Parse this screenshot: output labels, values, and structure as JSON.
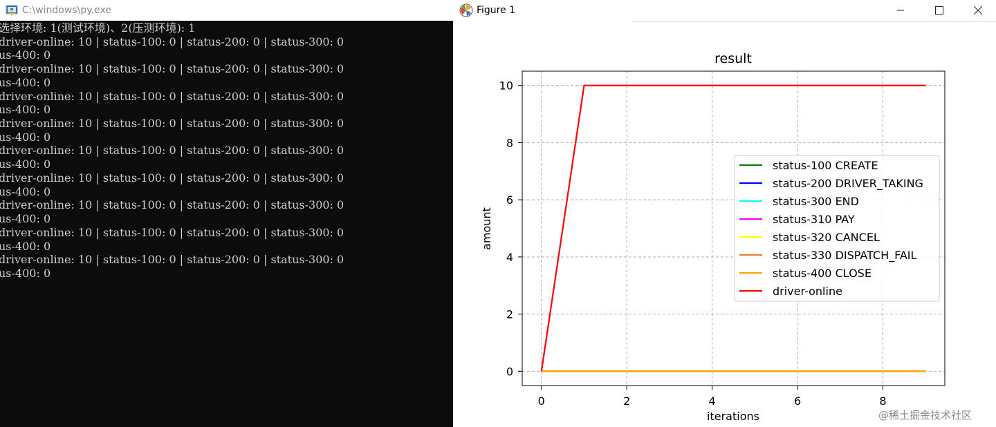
{
  "console": {
    "title": "C:\\windows\\py.exe",
    "lines": [
      "选择环境: 1(测试环境)、2(压测环境): 1",
      "driver-online: 10 | status-100: 0 | status-200: 0 | status-300: 0",
      "us-400: 0",
      "driver-online: 10 | status-100: 0 | status-200: 0 | status-300: 0",
      "us-400: 0",
      "driver-online: 10 | status-100: 0 | status-200: 0 | status-300: 0",
      "us-400: 0",
      "driver-online: 10 | status-100: 0 | status-200: 0 | status-300: 0",
      "us-400: 0",
      "driver-online: 10 | status-100: 0 | status-200: 0 | status-300: 0",
      "us-400: 0",
      "driver-online: 10 | status-100: 0 | status-200: 0 | status-300: 0",
      "us-400: 0",
      "driver-online: 10 | status-100: 0 | status-200: 0 | status-300: 0",
      "us-400: 0",
      "driver-online: 10 | status-100: 0 | status-200: 0 | status-300: 0",
      "us-400: 0",
      "driver-online: 10 | status-100: 0 | status-200: 0 | status-300: 0",
      "us-400: 0"
    ]
  },
  "figure_window": {
    "title": "Figure 1",
    "minimize_icon": "minimize-icon",
    "maximize_icon": "maximize-icon",
    "close_icon": "close-icon"
  },
  "chart_data": {
    "type": "line",
    "title": "result",
    "xlabel": "iterations",
    "ylabel": "amount",
    "x": [
      0,
      1,
      2,
      3,
      4,
      5,
      6,
      7,
      8,
      9
    ],
    "xlim": [
      -0.45,
      9.45
    ],
    "ylim": [
      -0.5,
      10.5
    ],
    "xticks": [
      0,
      2,
      4,
      6,
      8
    ],
    "yticks": [
      0,
      2,
      4,
      6,
      8,
      10
    ],
    "grid": true,
    "grid_style": "dashed",
    "legend_position": "center-right",
    "series": [
      {
        "name": "status-100 CREATE",
        "color": "#008000",
        "values": [
          0,
          0,
          0,
          0,
          0,
          0,
          0,
          0,
          0,
          0
        ]
      },
      {
        "name": "status-200 DRIVER_TAKING",
        "color": "#0000ff",
        "values": [
          0,
          0,
          0,
          0,
          0,
          0,
          0,
          0,
          0,
          0
        ]
      },
      {
        "name": "status-300 END",
        "color": "#00ffff",
        "values": [
          0,
          0,
          0,
          0,
          0,
          0,
          0,
          0,
          0,
          0
        ]
      },
      {
        "name": "status-310 PAY",
        "color": "#ff00ff",
        "values": [
          0,
          0,
          0,
          0,
          0,
          0,
          0,
          0,
          0,
          0
        ]
      },
      {
        "name": "status-320 CANCEL",
        "color": "#ffff00",
        "values": [
          0,
          0,
          0,
          0,
          0,
          0,
          0,
          0,
          0,
          0
        ]
      },
      {
        "name": "status-330 DISPATCH_FAIL",
        "color": "#ee7f2d",
        "values": [
          0,
          0,
          0,
          0,
          0,
          0,
          0,
          0,
          0,
          0
        ]
      },
      {
        "name": "status-400 CLOSE",
        "color": "#ffa500",
        "values": [
          0,
          0,
          0,
          0,
          0,
          0,
          0,
          0,
          0,
          0
        ]
      },
      {
        "name": "driver-online",
        "color": "#ff0000",
        "values": [
          0,
          10,
          10,
          10,
          10,
          10,
          10,
          10,
          10,
          10
        ]
      }
    ]
  },
  "watermark": "@稀土掘金技术社区"
}
